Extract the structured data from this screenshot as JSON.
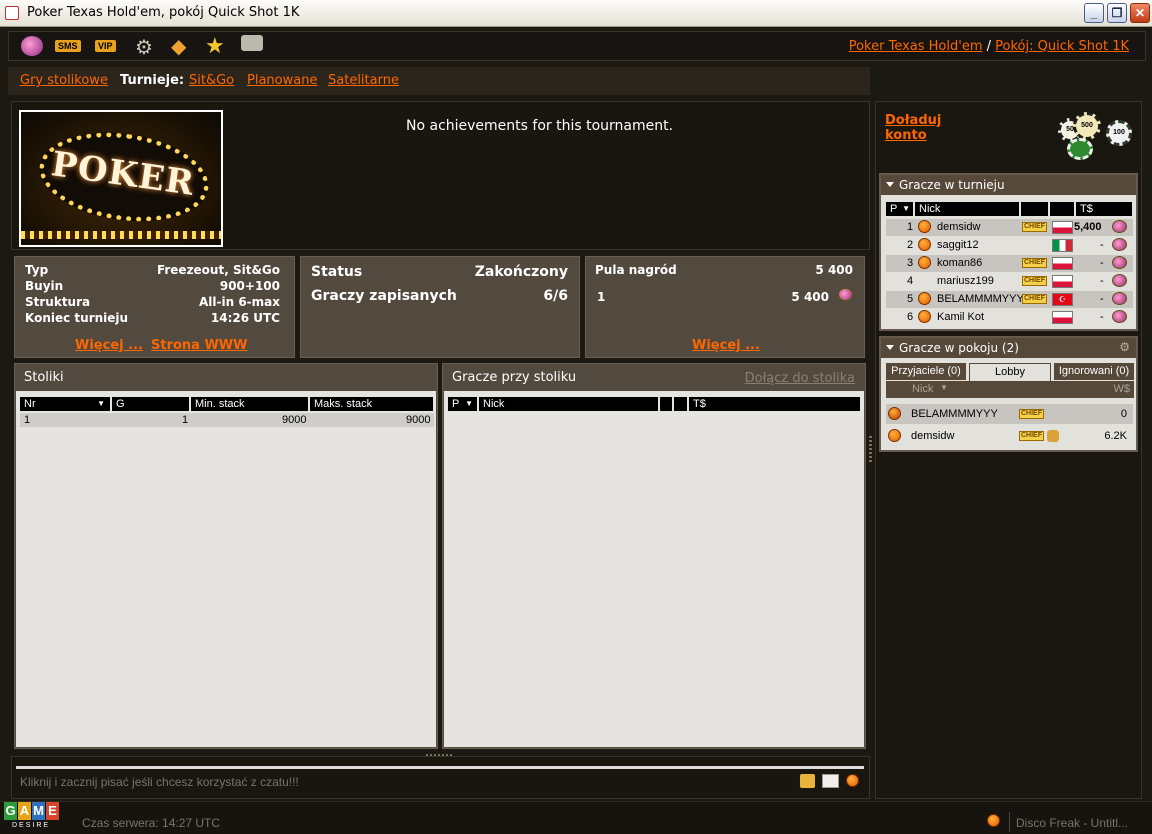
{
  "window": {
    "title": "Poker Texas Hold'em, pokój Quick Shot 1K"
  },
  "toolbar": {
    "icons": [
      "chips-icon",
      "sms-icon",
      "vip-icon",
      "gear-icon",
      "diamond-icon",
      "star-icon",
      "camera-icon"
    ],
    "sms_label": "SMS",
    "vip_label": "VIP",
    "breadcrumb_game": "Poker Texas Hold'em",
    "breadcrumb_sep": "/",
    "breadcrumb_room": "Pokój: Quick Shot 1K"
  },
  "nav": {
    "table_games": "Gry stolikowe",
    "tournaments_label": "Turnieje:",
    "sitgo": "Sit&Go",
    "planned": "Planowane",
    "satellite": "Satelitarne"
  },
  "main": {
    "image_text": "POKER",
    "no_achievements": "No achievements for this tournament."
  },
  "info_left": {
    "rows": [
      {
        "label": "Typ",
        "value": "Freezeout, Sit&Go"
      },
      {
        "label": "Buyin",
        "value": "900+100"
      },
      {
        "label": "Struktura",
        "value": "All-in 6-max"
      },
      {
        "label": "Koniec turnieju",
        "value": "14:26 UTC"
      }
    ],
    "more": "Więcej ...",
    "www": "Strona WWW"
  },
  "info_mid": {
    "status_label": "Status",
    "status_value": "Zakończony",
    "players_label": "Graczy zapisanych",
    "players_value": "6/6"
  },
  "info_right": {
    "pool_label": "Pula nagród",
    "pool_value": "5 400",
    "place": "1",
    "place_value": "5 400",
    "more": "Więcej ..."
  },
  "tables": {
    "title": "Stoliki",
    "columns": [
      "Nr",
      "G",
      "Min. stack",
      "Maks. stack"
    ],
    "rows": [
      {
        "nr": "1",
        "g": "1",
        "min": "9000",
        "max": "9000"
      }
    ]
  },
  "table_players": {
    "title": "Gracze przy stoliku",
    "join": "Dołącz do stolika",
    "columns": [
      "P",
      "Nick",
      "",
      "",
      "T$"
    ]
  },
  "chat": {
    "placeholder": "Kliknij i zacznij pisać jeśli chcesz korzystać z czatu!!!"
  },
  "status": {
    "server_time": "Czas serwera: 14:27 UTC",
    "music": "Disco Freak - Untitl...",
    "logo_letters": [
      "G",
      "A",
      "M",
      "E"
    ],
    "logo_sub": "DESIRE"
  },
  "account": {
    "recharge_line1": "Doładuj",
    "recharge_line2": "konto",
    "chip_values": [
      "50",
      "500",
      "100"
    ]
  },
  "tournament_players": {
    "title": "Gracze w turnieju",
    "columns": [
      "P",
      "Nick",
      "",
      "",
      "T$"
    ],
    "rows": [
      {
        "p": "1",
        "nick": "demsidw",
        "chief": true,
        "flag": "pl",
        "money": "5,400"
      },
      {
        "p": "2",
        "nick": "saggit12",
        "chief": false,
        "flag": "it",
        "money": "-"
      },
      {
        "p": "3",
        "nick": "koman86",
        "chief": true,
        "flag": "pl",
        "money": "-"
      },
      {
        "p": "4",
        "nick": "mariusz199",
        "chief": true,
        "flag": "pl",
        "money": "-"
      },
      {
        "p": "5",
        "nick": "BELAMMMMYYY",
        "chief": true,
        "flag": "tr",
        "money": "-"
      },
      {
        "p": "6",
        "nick": "Kamil Kot",
        "chief": false,
        "flag": "pl",
        "money": "-"
      }
    ]
  },
  "room_players": {
    "title": "Gracze w pokoju (2)",
    "tabs": [
      "Przyjaciele (0)",
      "Lobby",
      "Ignorowani (0)"
    ],
    "col_nick": "Nick",
    "col_money": "W$",
    "chief_label": "CHIEF",
    "rows": [
      {
        "nick": "BELAMMMMYYY",
        "money": "0"
      },
      {
        "nick": "demsidw",
        "money": "6.2K"
      }
    ]
  }
}
